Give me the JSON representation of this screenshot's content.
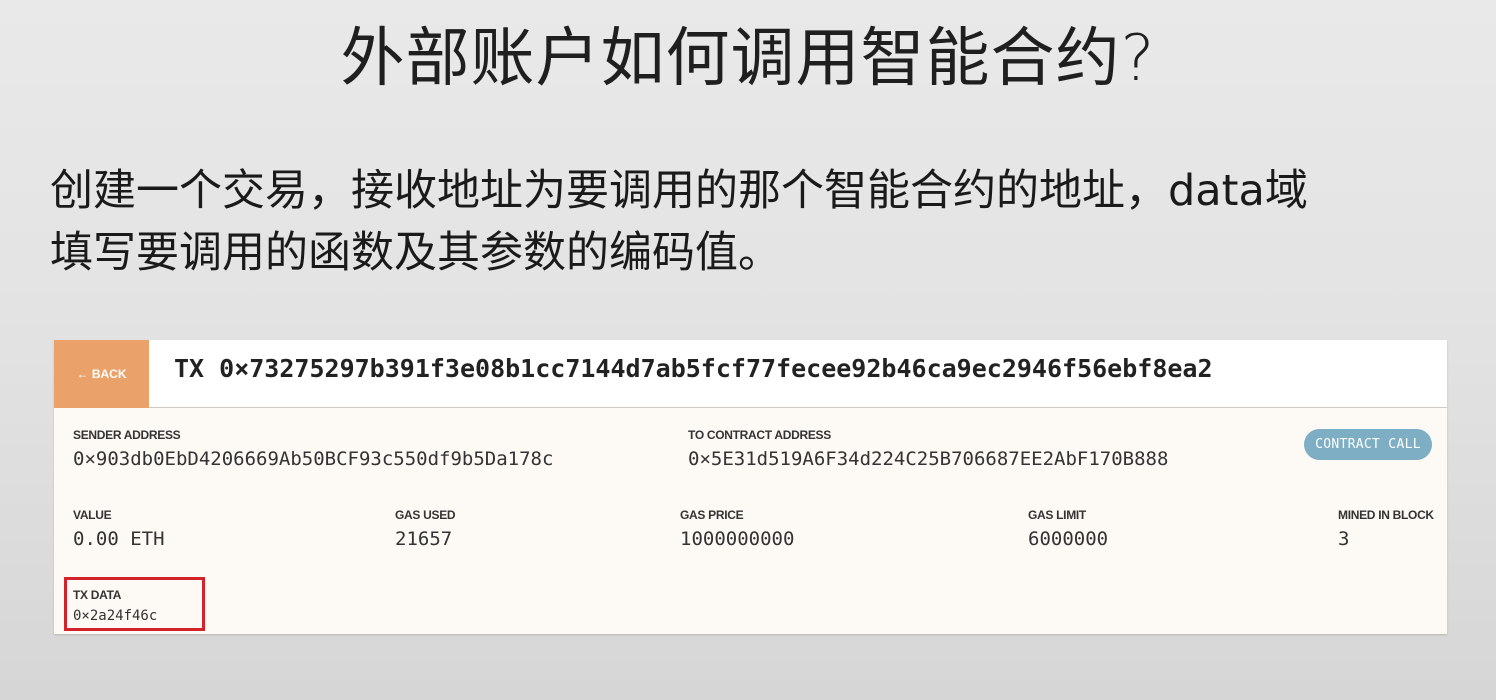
{
  "slide": {
    "title": "外部账户如何调用智能合约?",
    "body_line1": "创建一个交易，接收地址为要调用的那个智能合约的地址，data域",
    "body_line2": "填写要调用的函数及其参数的编码值。"
  },
  "tx": {
    "back_label": "← BACK",
    "hash": "TX 0×73275297b391f3e08b1cc7144d7ab5fcf77fecee92b46ca9ec2946f56ebf8ea2",
    "sender_label": "SENDER ADDRESS",
    "sender_value": "0×903db0EbD4206669Ab50BCF93c550df9b5Da178c",
    "to_label": "TO CONTRACT ADDRESS",
    "to_value": "0×5E31d519A6F34d224C25B706687EE2AbF170B888",
    "badge": "CONTRACT CALL",
    "value_label": "VALUE",
    "value_value": "0.00 ETH",
    "gas_used_label": "GAS USED",
    "gas_used_value": "21657",
    "gas_price_label": "GAS PRICE",
    "gas_price_value": "1000000000",
    "gas_limit_label": "GAS LIMIT",
    "gas_limit_value": "6000000",
    "block_label": "MINED IN BLOCK",
    "block_value": "3",
    "data_label": "TX DATA",
    "data_value": "0×2a24f46c"
  },
  "colors": {
    "back_button": "#eba26a",
    "badge": "#7eaec4",
    "highlight": "#d3232a",
    "panel_bg": "#fdf9f5"
  }
}
